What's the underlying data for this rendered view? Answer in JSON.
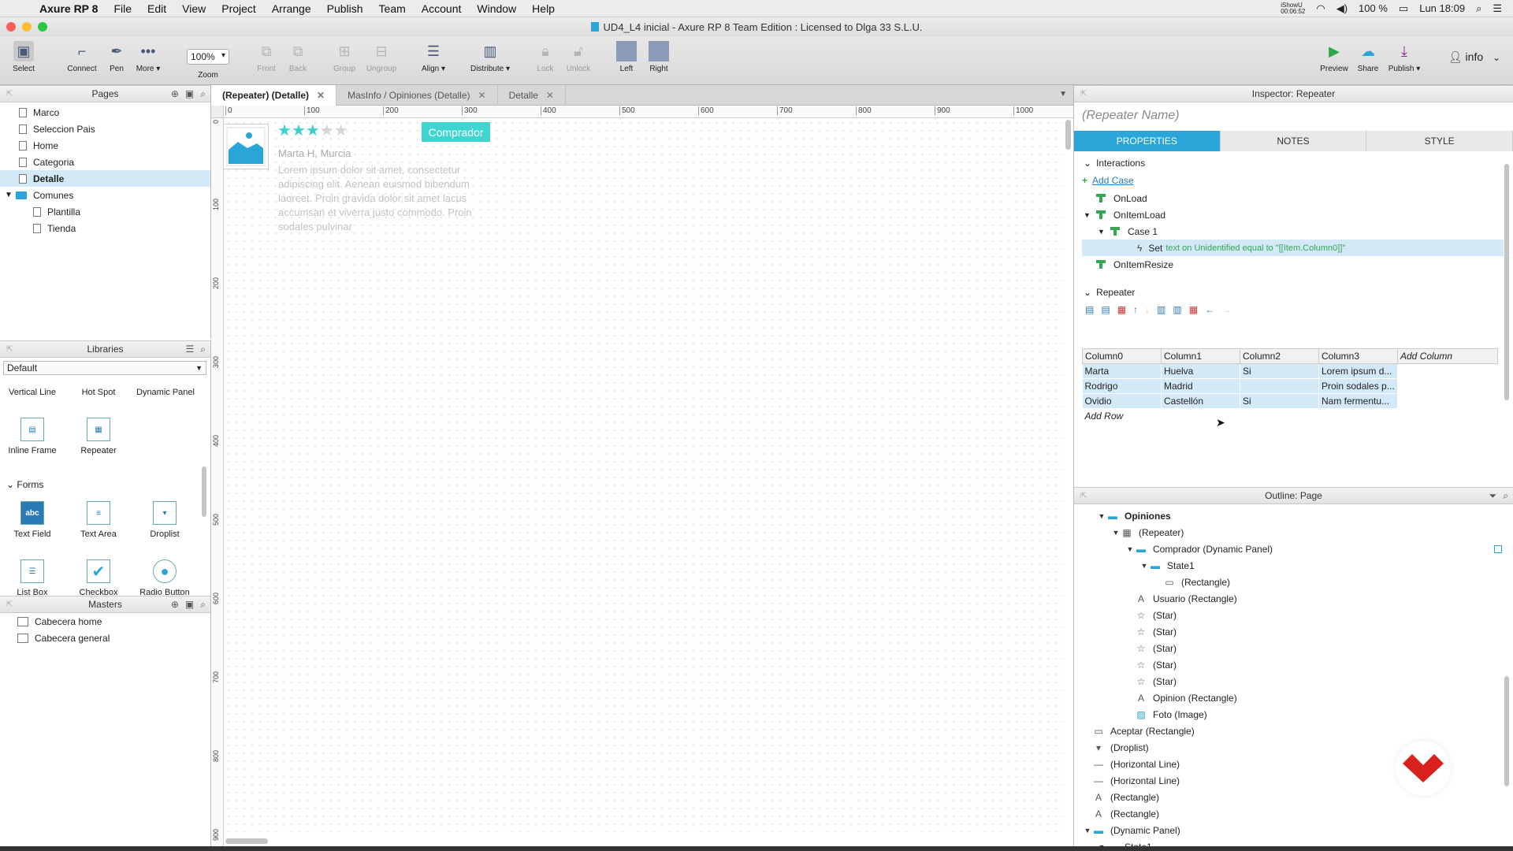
{
  "menubar": {
    "app_name": "Axure RP 8",
    "items": [
      "File",
      "Edit",
      "View",
      "Project",
      "Arrange",
      "Publish",
      "Team",
      "Account",
      "Window",
      "Help"
    ],
    "status_right": {
      "recorder": "iShowU\n00:06:52",
      "battery": "100 %",
      "clock": "Lun 18:09"
    }
  },
  "window": {
    "title": "UD4_L4 inicial - Axure RP 8 Team Edition : Licensed to Dlga 33 S.L.U."
  },
  "toolbar": {
    "select": "Select",
    "connect": "Connect",
    "pen": "Pen",
    "more": "More ▾",
    "zoom_value": "100%",
    "zoom": "Zoom",
    "front": "Front",
    "back": "Back",
    "group": "Group",
    "ungroup": "Ungroup",
    "align": "Align ▾",
    "distribute": "Distribute ▾",
    "lock": "Lock",
    "unlock": "Unlock",
    "left": "Left",
    "right": "Right",
    "preview": "Preview",
    "share": "Share",
    "publish": "Publish ▾",
    "user": "info"
  },
  "pages_panel": {
    "title": "Pages",
    "items": [
      {
        "label": "Marco"
      },
      {
        "label": "Seleccion Pais"
      },
      {
        "label": "Home"
      },
      {
        "label": "Categoria"
      },
      {
        "label": "Detalle",
        "selected": true
      },
      {
        "label": "Comunes",
        "folder": true
      },
      {
        "label": "Plantilla",
        "child": true
      },
      {
        "label": "Tienda",
        "child": true
      }
    ]
  },
  "libraries_panel": {
    "title": "Libraries",
    "selected_library": "Default",
    "row1": [
      "Vertical Line",
      "Hot Spot",
      "Dynamic Panel"
    ],
    "row2": [
      "Inline Frame",
      "Repeater"
    ],
    "forms_section": "Forms",
    "forms": [
      "Text Field",
      "Text Area",
      "Droplist",
      "List Box",
      "Checkbox",
      "Radio Button"
    ],
    "icon_text_field": "abc"
  },
  "masters_panel": {
    "title": "Masters",
    "items": [
      "Cabecera home",
      "Cabecera general"
    ]
  },
  "canvas": {
    "tabs": [
      {
        "label": "(Repeater) (Detalle)",
        "active": true
      },
      {
        "label": "MasInfo / Opiniones (Detalle)"
      },
      {
        "label": "Detalle"
      }
    ],
    "hruler_ticks": [
      "0",
      "100",
      "200",
      "300",
      "400",
      "500",
      "600",
      "700",
      "800",
      "900",
      "1000"
    ],
    "vruler_ticks": [
      "0",
      "100",
      "200",
      "300",
      "400",
      "500",
      "600",
      "700",
      "800",
      "900"
    ],
    "widget": {
      "stars_filled": 3,
      "stars_total": 5,
      "badge": "Comprador",
      "user": "Marta H, Murcia",
      "lorem": "Lorem ipsum dolor sit amet, consectetur adipiscing elit. Aenean euismod bibendum laoreet. Proin gravida dolor sit amet lacus accumsan et viverra justo commodo. Proin sodales pulvinar"
    }
  },
  "inspector": {
    "title": "Inspector: Repeater",
    "name_placeholder": "(Repeater Name)",
    "tabs": [
      "PROPERTIES",
      "NOTES",
      "STYLE"
    ],
    "interactions_title": "Interactions",
    "add_case": "Add Case",
    "events": {
      "onload": "OnLoad",
      "onitemload": "OnItemLoad",
      "case1": "Case 1",
      "action_prefix": "Set",
      "action_text": "text on Unidentified equal to \"[[Item.Column0]]\"",
      "onitemresize": "OnItemResize"
    },
    "repeater_title": "Repeater",
    "columns": [
      "Column0",
      "Column1",
      "Column2",
      "Column3",
      "Add Column"
    ],
    "rows": [
      [
        "Marta",
        "Huelva",
        "Si",
        "Lorem ipsum d..."
      ],
      [
        "Rodrigo",
        "Madrid",
        "",
        "Proin sodales p..."
      ],
      [
        "Ovidio",
        "Castellón",
        "Si",
        "Nam fermentu..."
      ]
    ],
    "add_row": "Add Row"
  },
  "outline": {
    "title": "Outline: Page",
    "items": [
      {
        "label": "Opiniones",
        "indent": 1,
        "arrow": "▼",
        "icon": "panel",
        "bold": true
      },
      {
        "label": "(Repeater)",
        "indent": 2,
        "arrow": "▼",
        "icon": "table"
      },
      {
        "label": "Comprador (Dynamic Panel)",
        "indent": 3,
        "arrow": "▼",
        "icon": "panel"
      },
      {
        "label": "State1",
        "indent": 4,
        "arrow": "▼",
        "icon": "state"
      },
      {
        "label": "(Rectangle)",
        "indent": 5,
        "arrow": "",
        "icon": "rect"
      },
      {
        "label": "Usuario (Rectangle)",
        "indent": 3,
        "arrow": "",
        "icon": "text"
      },
      {
        "label": "(Star)",
        "indent": 3,
        "arrow": "",
        "icon": "star"
      },
      {
        "label": "(Star)",
        "indent": 3,
        "arrow": "",
        "icon": "star"
      },
      {
        "label": "(Star)",
        "indent": 3,
        "arrow": "",
        "icon": "star"
      },
      {
        "label": "(Star)",
        "indent": 3,
        "arrow": "",
        "icon": "star"
      },
      {
        "label": "(Star)",
        "indent": 3,
        "arrow": "",
        "icon": "star"
      },
      {
        "label": "Opinion (Rectangle)",
        "indent": 3,
        "arrow": "",
        "icon": "text"
      },
      {
        "label": "Foto (Image)",
        "indent": 3,
        "arrow": "",
        "icon": "image"
      },
      {
        "label": "Aceptar (Rectangle)",
        "indent": 0,
        "arrow": "",
        "icon": "rect"
      },
      {
        "label": "(Droplist)",
        "indent": 0,
        "arrow": "",
        "icon": "droplist"
      },
      {
        "label": "(Horizontal Line)",
        "indent": 0,
        "arrow": "",
        "icon": "line"
      },
      {
        "label": "(Horizontal Line)",
        "indent": 0,
        "arrow": "",
        "icon": "line"
      },
      {
        "label": "(Rectangle)",
        "indent": 0,
        "arrow": "",
        "icon": "text"
      },
      {
        "label": "(Rectangle)",
        "indent": 0,
        "arrow": "",
        "icon": "text"
      },
      {
        "label": "(Dynamic Panel)",
        "indent": 0,
        "arrow": "▼",
        "icon": "panel"
      },
      {
        "label": "State1",
        "indent": 1,
        "arrow": "▼",
        "icon": "state"
      }
    ]
  },
  "colors": {
    "accent": "#2aa5d8",
    "selection": "#d4e9f7",
    "badge": "#3fd6d2",
    "star": "#3ecfcb",
    "logo": "#d8201c",
    "event_green": "#32a852"
  }
}
